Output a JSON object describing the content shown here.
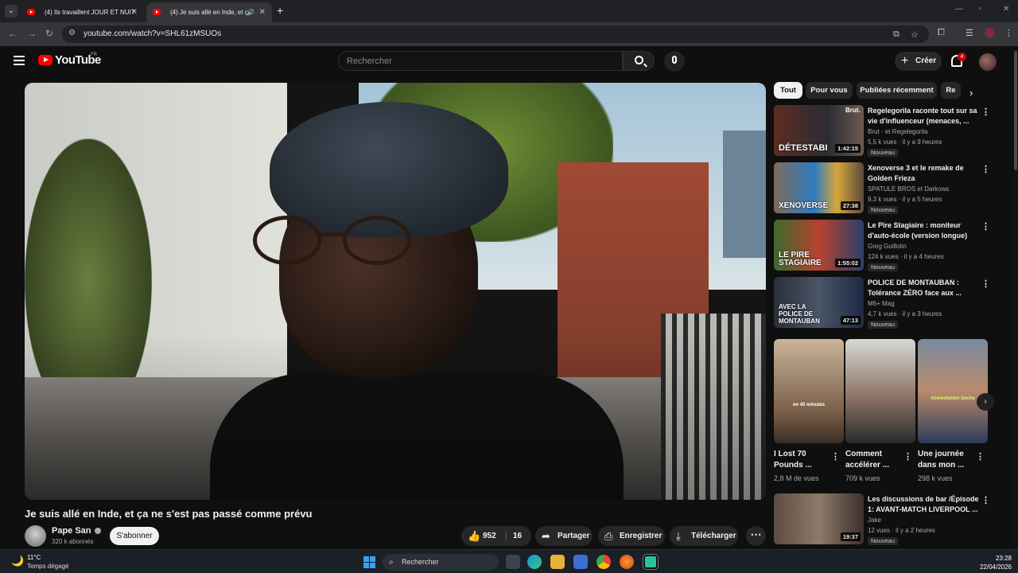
{
  "browser": {
    "tabs": [
      {
        "title": "(4) Ils travaillent JOUR ET NUIT",
        "active": false
      },
      {
        "title": "(4) Je suis allé en Inde, et ça",
        "active": true
      }
    ],
    "url": "youtube.com/watch?v=SHL61zMSUOs"
  },
  "header": {
    "logo_text": "YouTube",
    "region": "FR",
    "search_placeholder": "Rechercher",
    "create_label": "Créer",
    "notif_count": "4"
  },
  "video": {
    "title": "Je suis allé en Inde, et ça ne s'est pas passé comme prévu",
    "channel": "Pape San",
    "subscribers": "320 k abonnés",
    "subscribe_label": "S'abonner",
    "likes": "952",
    "dislikes": "16",
    "share_label": "Partager",
    "save_label": "Enregistrer",
    "download_label": "Télécharger"
  },
  "chips": [
    "Tout",
    "Pour vous",
    "Publiées récemment",
    "Re"
  ],
  "recommendations": [
    {
      "title": "Regelegorila raconte tout sur sa vie d'influenceur (menaces, ...",
      "channel": "Brut · et Regelegorila",
      "meta": "5,5 k vues · il y a 9 heures",
      "badge": "Nouveau",
      "duration": "1:42:15",
      "thumb_text": "DÉTESTABI",
      "thumb_brand": "Brut."
    },
    {
      "title": "Xenoverse 3 et le remake de Golden Frieza",
      "channel": "SPATULE BROS et Darkows",
      "meta": "9,3 k vues · il y a 5 heures",
      "badge": "Nouveau",
      "duration": "27:38",
      "thumb_text": "XENOVERSE"
    },
    {
      "title": "Le Pire Stagiaire : moniteur d'auto-école (version longue)",
      "channel": "Greg Guillotin",
      "meta": "124 k vues · il y a 4 heures",
      "badge": "Nouveau",
      "duration": "1:55:02",
      "thumb_text": "LE PIRE STAGIAIRE"
    },
    {
      "title": "POLICE DE MONTAUBAN : Tolérance ZÉRO face aux ...",
      "channel": "M6+ Mag",
      "meta": "4,7 k vues · il y a 3 heures",
      "badge": "Nouveau",
      "duration": "47:13",
      "thumb_text": "AVEC LA POLICE DE MONTAUBAN"
    },
    {
      "title": "Les discussions de bar /Épisode 1: AVANT-MATCH LIVERPOOL ...",
      "channel": "Jake",
      "meta": "12 vues · il y a 2 heures",
      "badge": "Nouveau",
      "duration": "19:37"
    }
  ],
  "shorts": [
    {
      "title": "I Lost 70 Pounds ...",
      "views": "2,8 M de vues",
      "caption": "en 40 minutes"
    },
    {
      "title": "Comment accélérer ...",
      "views": "709 k vues",
      "caption": ""
    },
    {
      "title": "Une journée dans mon ...",
      "views": "298 k vues",
      "caption": "Alimentation Sèche"
    }
  ],
  "taskbar": {
    "temp": "11°C",
    "weather": "Temps dégagé",
    "search": "Rechercher",
    "time": "23:28",
    "date": "22/04/2026"
  },
  "colors": {
    "yt_red": "#ff0000",
    "bg": "#0f0f0f",
    "chip": "#272727"
  }
}
